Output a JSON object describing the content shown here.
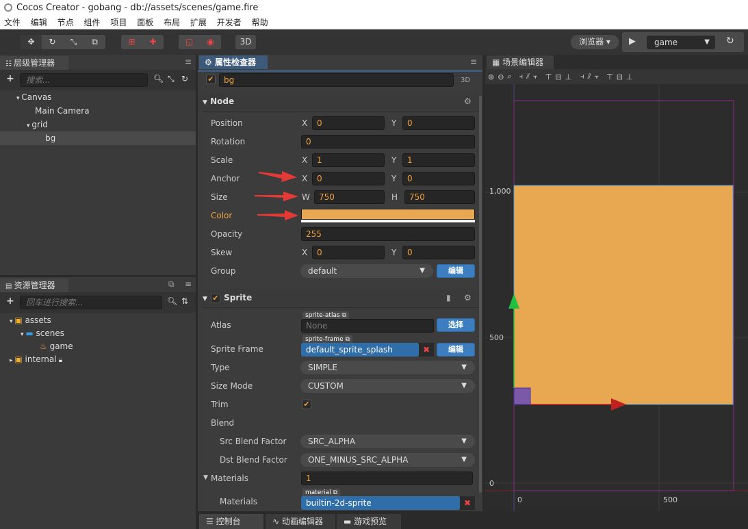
{
  "window": {
    "title": "Cocos Creator - gobang - db://assets/scenes/game.fire"
  },
  "menu": [
    "文件",
    "编辑",
    "节点",
    "组件",
    "项目",
    "面板",
    "布局",
    "扩展",
    "开发者",
    "帮助"
  ],
  "toolbar": {
    "tools_3d": "3D",
    "browser_label": "浏览器",
    "scene_select": "game",
    "play_icon": "play-icon",
    "refresh_icon": "refresh-icon"
  },
  "hierarchy": {
    "tab": "层级管理器",
    "search_placeholder": "搜索...",
    "nodes": [
      {
        "label": "Canvas",
        "depth": 1,
        "expanded": true
      },
      {
        "label": "Main Camera",
        "depth": 2
      },
      {
        "label": "grid",
        "depth": 2,
        "expanded": true
      },
      {
        "label": "bg",
        "depth": 3,
        "selected": true
      }
    ]
  },
  "assets": {
    "tab": "资源管理器",
    "search_placeholder": "回车进行搜索...",
    "items": [
      {
        "label": "assets",
        "depth": 1
      },
      {
        "label": "scenes",
        "depth": 2
      },
      {
        "label": "game",
        "depth": 3
      },
      {
        "label": "internal",
        "depth": 1
      }
    ]
  },
  "inspector": {
    "tab": "属性检查器",
    "node_name": "bg",
    "mode_3d": "3D",
    "node_section": "Node",
    "position": {
      "label": "Position",
      "x": "0",
      "y": "0"
    },
    "rotation": {
      "label": "Rotation",
      "value": "0"
    },
    "scale": {
      "label": "Scale",
      "x": "1",
      "y": "1"
    },
    "anchor": {
      "label": "Anchor",
      "x": "0",
      "y": "0"
    },
    "size": {
      "label": "Size",
      "w": "750",
      "h": "750"
    },
    "color": {
      "label": "Color",
      "value": "#e8a852"
    },
    "opacity": {
      "label": "Opacity",
      "value": "255"
    },
    "skew": {
      "label": "Skew",
      "x": "0",
      "y": "0"
    },
    "group": {
      "label": "Group",
      "value": "default",
      "edit": "编辑"
    },
    "axis_x": "X",
    "axis_y": "Y",
    "axis_w": "W",
    "axis_h": "H",
    "sprite_section": "Sprite",
    "atlas": {
      "label": "Atlas",
      "tag": "sprite-atlas",
      "value": "None",
      "button": "选择"
    },
    "sprite_frame": {
      "label": "Sprite Frame",
      "tag": "sprite-frame",
      "value": "default_sprite_splash",
      "button": "编辑"
    },
    "type": {
      "label": "Type",
      "value": "SIMPLE"
    },
    "size_mode": {
      "label": "Size Mode",
      "value": "CUSTOM"
    },
    "trim": {
      "label": "Trim"
    },
    "blend": {
      "label": "Blend"
    },
    "src_blend": {
      "label": "Src Blend Factor",
      "value": "SRC_ALPHA"
    },
    "dst_blend": {
      "label": "Dst Blend Factor",
      "value": "ONE_MINUS_SRC_ALPHA"
    },
    "materials_count": {
      "label": "Materials",
      "value": "1"
    },
    "materials_item": {
      "label": "Materials",
      "tag": "material",
      "value": "builtin-2d-sprite"
    }
  },
  "scene": {
    "tab": "场景编辑器",
    "y_labels": [
      "1,000",
      "500",
      "0"
    ],
    "x_labels": [
      "0",
      "500"
    ]
  },
  "bottom_tabs": [
    "控制台",
    "动画编辑器",
    "游戏预览"
  ],
  "colors": {
    "accent": "#3c7ec0",
    "sprite": "#e8a852",
    "highlight": "#f0a040"
  }
}
